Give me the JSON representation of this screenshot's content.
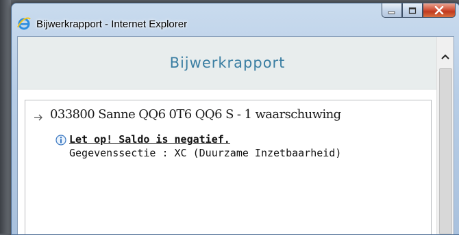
{
  "window": {
    "title": "Bijwerkrapport - Internet Explorer",
    "icon": "internet-explorer-icon"
  },
  "caption_buttons": {
    "minimize_icon": "minimize-icon",
    "maximize_icon": "maximize-icon",
    "close_icon": "close-icon"
  },
  "page": {
    "title": "Bijwerkrapport"
  },
  "report": {
    "line": "033800 Sanne QQ6 0T6 QQ6 S - 1 waarschuwing",
    "warning": {
      "title": "Let op! Saldo is negatief.",
      "detail": "Gegevenssectie : XC (Duurzame Inzetbaarheid)"
    }
  },
  "colors": {
    "page_title": "#3a7ea2",
    "header_band": "#e8eded",
    "close_button": "#c03a1f"
  }
}
